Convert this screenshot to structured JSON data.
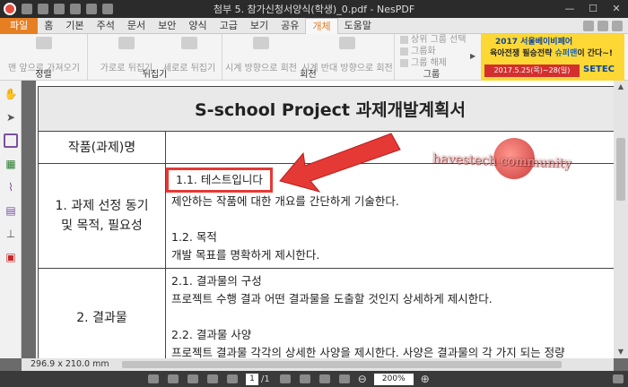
{
  "window": {
    "title": "첨부 5. 참가신청서양식(학생)_0.pdf - NesPDF"
  },
  "menu": {
    "tabs": [
      "파일",
      "홈",
      "기본",
      "주석",
      "문서",
      "보안",
      "양식",
      "고급",
      "보기",
      "공유",
      "개체",
      "도움말"
    ],
    "active_tab": "개체"
  },
  "ribbon": {
    "group_align": {
      "label": "정렬",
      "buttons": [
        "맨 앞으로 가져오기"
      ]
    },
    "group_flip": {
      "label": "뒤집기",
      "buttons": [
        "가로로 뒤집기",
        "세로로 뒤집기"
      ]
    },
    "group_rotate": {
      "label": "회전",
      "buttons": [
        "시계 방향으로 회전",
        "시계 반대 방향으로 회전"
      ]
    },
    "group_group": {
      "label": "그룹",
      "items": [
        "상위 그룹 선택",
        "그룹화",
        "그룹 해제"
      ]
    },
    "ad": {
      "line1": "2017 서울베이비페어",
      "line2a": "육아전쟁 필승전략 ",
      "line2b": "슈퍼맨",
      "line2c": "이 간다~!",
      "date": "2017.5.25(목)~28(일)",
      "brand": "SETEC"
    }
  },
  "document": {
    "title": "S-school  Project  과제개발계획서",
    "rows": [
      {
        "label": "작품(과제)명",
        "content": []
      },
      {
        "label_lines": [
          "1. 과제 선정 동기",
          "및 목적, 필요성"
        ],
        "highlighted": "1.1. 테스트입니다",
        "lines": [
          "제안하는 작품에 대한 개요를 간단하게 기술한다.",
          "",
          "1.2. 목적",
          "개발 목표를 명확하게 제시한다."
        ]
      },
      {
        "label": "2. 결과물",
        "lines": [
          "2.1. 결과물의 구성",
          "프로젝트 수행 결과 어떤 결과물을 도출할 것인지 상세하게 제시한다.",
          "",
          "2.2. 결과물 사양",
          "프로젝트 결과물 각각의 상세한 사양을 제시한다. 사양은 결과물의 각 가지 되는 정량"
        ]
      }
    ],
    "watermark": "havestech community"
  },
  "statusbar": {
    "page_size": "296.9 x 210.0 mm",
    "current_page": "1",
    "page_total": "/1",
    "zoom": "200%"
  },
  "colors": {
    "accent": "#e67e22",
    "highlight": "#e53935"
  }
}
